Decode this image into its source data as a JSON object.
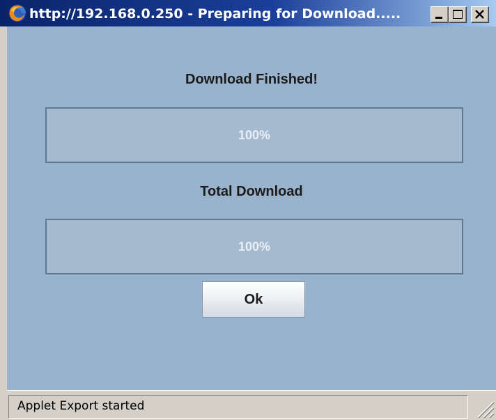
{
  "window": {
    "title": "http://192.168.0.250 - Preparing for Download....."
  },
  "dialog": {
    "file_status": "Download Finished!",
    "file_progress": {
      "label": "100%",
      "fraction": 1.0
    },
    "total_label": "Total Download",
    "total_progress": {
      "label": "100%",
      "fraction": 1.0
    },
    "ok_label": "Ok"
  },
  "statusbar": {
    "text": "Applet Export started"
  },
  "colors": {
    "content_bg": "#99b3cc",
    "progress_fill": "#a5b9cf",
    "progress_text": "#e8eef6",
    "titlebar_start": "#0a246a",
    "titlebar_end": "#a6caf0"
  }
}
